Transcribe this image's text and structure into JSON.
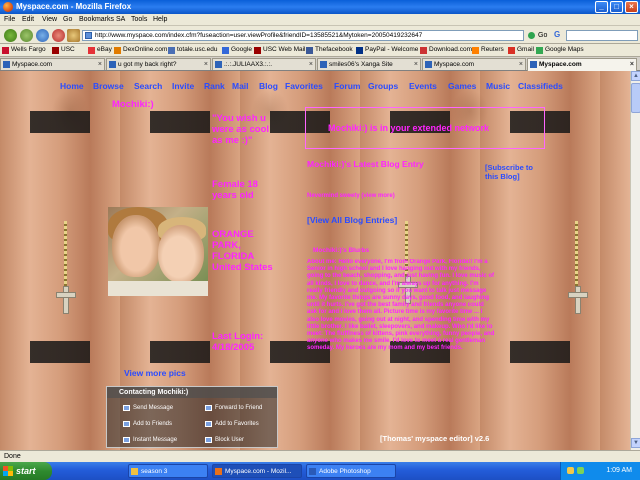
{
  "window": {
    "title": "Myspace.com - Mozilla Firefox",
    "minimize_glyph": "_",
    "maximize_glyph": "□",
    "close_glyph": "×"
  },
  "menu": [
    "File",
    "Edit",
    "View",
    "Go",
    "Bookmarks",
    "SA",
    "Tools",
    "Help"
  ],
  "nav": {
    "url": "http://www.myspace.com/index.cfm?fuseaction=user.viewProfile&friendID=13585521&Mytoken=20050419232647",
    "go_label": "Go",
    "google_letter": "G"
  },
  "bookmarks": [
    {
      "label": "Wells Fargo",
      "color": "#c8102e"
    },
    {
      "label": "USC",
      "color": "#990000"
    },
    {
      "label": "eBay",
      "color": "#e53238"
    },
    {
      "label": "DexOnline.com",
      "color": "#e07b00"
    },
    {
      "label": "totale.usc.edu",
      "color": "#4a6fb5"
    },
    {
      "label": "Google",
      "color": "#3368d9"
    },
    {
      "label": "USC Web Mail",
      "color": "#990000"
    },
    {
      "label": "Thefacebook",
      "color": "#3b5998"
    },
    {
      "label": "PayPal - Welcome",
      "color": "#003087"
    },
    {
      "label": "Download.com",
      "color": "#cc3333"
    },
    {
      "label": "Reuters",
      "color": "#ff8000"
    },
    {
      "label": "Gmail",
      "color": "#d93025"
    },
    {
      "label": "Google Maps",
      "color": "#34a853"
    }
  ],
  "tabs": [
    {
      "label": "Myspace.com",
      "active": false
    },
    {
      "label": "u got my back right?",
      "active": false
    },
    {
      "label": ".:.:.JULIAAX3.:.:.",
      "active": false
    },
    {
      "label": "smiles06's Xanga Site",
      "active": false
    },
    {
      "label": "Myspace.com",
      "active": false
    },
    {
      "label": "Myspace.com",
      "active": true
    }
  ],
  "tab_close_glyph": "×",
  "profile": {
    "nav_links": [
      "Home",
      "Browse",
      "Search",
      "Invite",
      "Rank",
      "Mail",
      "Blog",
      "Favorites",
      "Forum",
      "Groups",
      "Events",
      "Games",
      "Music",
      "Classifieds"
    ],
    "handle": "Mochiki:)",
    "mood_quote": "\"You wish u were as cool as me :)\"",
    "gender_age": "Female 18 years old",
    "location": "ORANGE PARK, FLORIDA United States",
    "last_login": "Last Login: 4/18/2005",
    "view_pics": "View more pics",
    "extended_network": "Mochiki:) is in your extended network",
    "blog_title": "Mochiki:)'s Latest Blog Entry",
    "subscribe": "[Subscribe to this Blog]",
    "blog_entry": "Nevermind sweety (view more)",
    "view_all_blog": "[View All Blog Entries]",
    "about_heading": "Mochiki:)'s Blurbs",
    "about_text": "About me: Hello everyone, I'm from Orange Park, Florida!! I'm a Senior in high school and I love hanging out with my friends, going to the beach, shopping, and just having fun. I love music of all kinds, I love to dance, and I'm always up for anything. I'm really friendly and outgoing so if you want to talk just message me. My favorite things are sunny days, good food, and laughing until it hurts. I've got the best family and friends anyone could ask for and I love them all. Picture time is my favorite time ... I also love movies, going out at night, and spending time with my little brother. I like ballet, sleepovers, and makeup. Who I'd like to meet: The fluffiness of kittens, pink everything, funny people, and anyone who makes me smile. I'd love to meet a real gentleman someday. My heroes are my mom and my best friends.",
    "editor_credit": "[Thomas' myspace editor] v2.6"
  },
  "contact": {
    "title": "Contacting Mochiki:)",
    "links": [
      "Send Message",
      "Forward to Friend",
      "Add to Friends",
      "Add to Favorites",
      "Instant Message",
      "Block User"
    ]
  },
  "status": "Done",
  "taskbar": {
    "start": "start",
    "apps": [
      {
        "label": "season 3",
        "active": false,
        "color": "#f0c040"
      },
      {
        "label": "Myspace.com - Mozil...",
        "active": true,
        "color": "#e8701a"
      },
      {
        "label": "Adobe Photoshop",
        "active": false,
        "color": "#2a5ab8"
      }
    ],
    "clock": "1:09 AM"
  },
  "colors": {
    "profile_text": "#ff24ff",
    "nav_link": "#2a4cff"
  }
}
